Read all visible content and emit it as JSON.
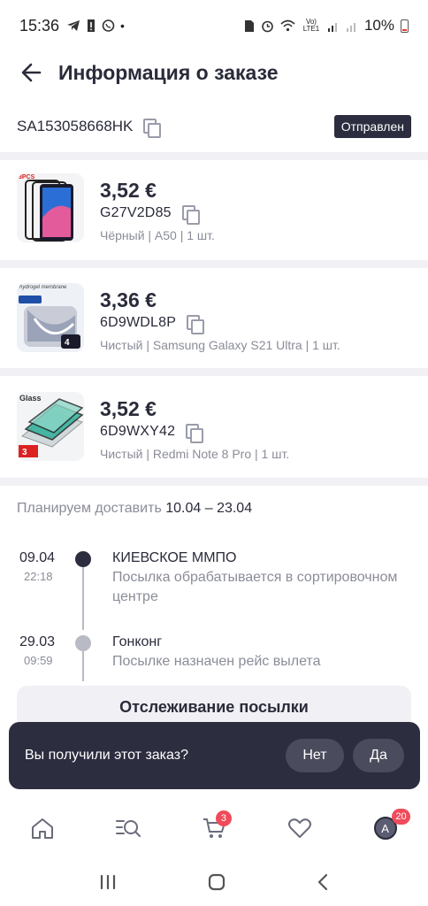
{
  "status_bar": {
    "time": "15:36",
    "battery": "10%",
    "network": "Vo) LTE1"
  },
  "header": {
    "title": "Информация о заказе"
  },
  "order": {
    "id": "SA153058668HK",
    "status": "Отправлен"
  },
  "products": [
    {
      "price": "3,52 €",
      "sku": "G27V2D85",
      "variant": "Чёрный | A50 | 1 шт.",
      "thumb_label": "3PCS"
    },
    {
      "price": "3,36 €",
      "sku": "6D9WDL8P",
      "variant": "Чистый | Samsung Galaxy S21 Ultra | 1 шт.",
      "thumb_label": "hydrogel membrane"
    },
    {
      "price": "3,52 €",
      "sku": "6D9WXY42",
      "variant": "Чистый | Redmi Note 8 Pro | 1 шт.",
      "thumb_label": "Glass"
    }
  ],
  "delivery": {
    "label": "Планируем доставить",
    "dates": "10.04 – 23.04"
  },
  "tracking": [
    {
      "date": "09.04",
      "time": "22:18",
      "place": "КИЕВСКОЕ ММПО",
      "desc": "Посылка обрабатывается в сортировочном центре",
      "active": true
    },
    {
      "date": "29.03",
      "time": "09:59",
      "place": "Гонконг",
      "desc": "Посылке назначен рейс вылета",
      "active": false
    }
  ],
  "track_button": "Отслеживание посылки",
  "prompt": {
    "text": "Вы получили этот заказ?",
    "no": "Нет",
    "yes": "Да"
  },
  "tabbar": {
    "cart_badge": "3",
    "profile_badge": "20",
    "avatar_letter": "A"
  },
  "colors": {
    "dark": "#2c2d3f",
    "accent_badge": "#f04b5a",
    "muted": "#8a8c98"
  }
}
